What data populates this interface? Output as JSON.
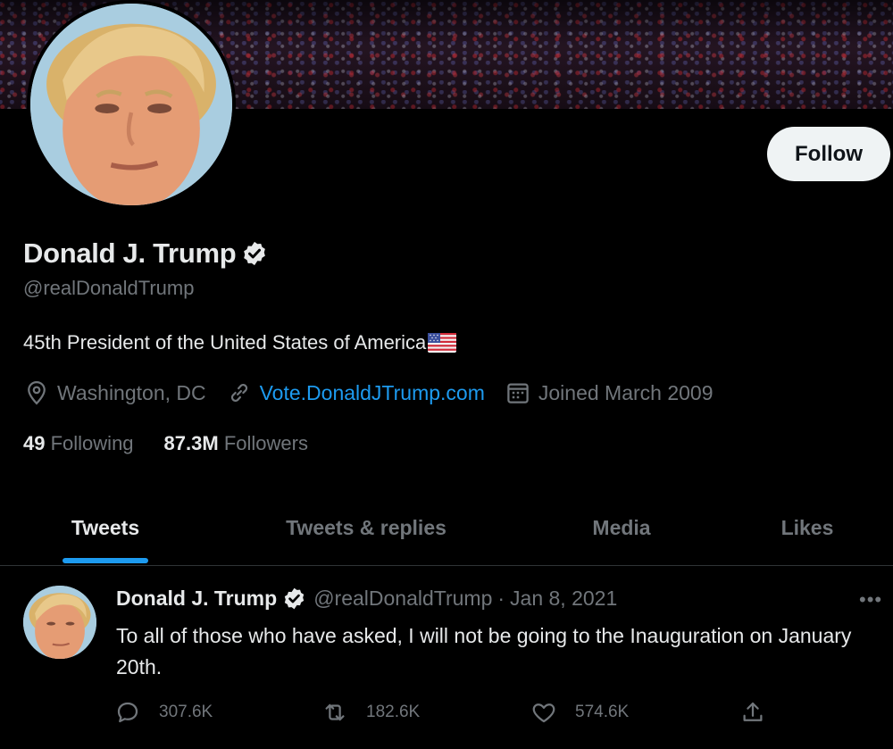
{
  "profile": {
    "display_name": "Donald J. Trump",
    "handle": "@realDonaldTrump",
    "bio": "45th President of the United States of America",
    "location": "Washington, DC",
    "website": "Vote.DonaldJTrump.com",
    "joined": "Joined March 2009",
    "following_count": "49",
    "following_label": "Following",
    "followers_count": "87.3M",
    "followers_label": "Followers",
    "follow_button": "Follow"
  },
  "tabs": [
    {
      "label": "Tweets",
      "active": true
    },
    {
      "label": "Tweets & replies",
      "active": false
    },
    {
      "label": "Media",
      "active": false
    },
    {
      "label": "Likes",
      "active": false
    }
  ],
  "tweet": {
    "author": "Donald J. Trump",
    "handle": "@realDonaldTrump",
    "separator": "·",
    "date": "Jan 8, 2021",
    "text": "To all of those who have asked, I will not be going to the Inauguration on January 20th.",
    "more": "•••",
    "replies": "307.6K",
    "retweets": "182.6K",
    "likes": "574.6K"
  },
  "icons": {
    "verified": "verified-badge-icon",
    "flag": "us-flag-icon",
    "location": "location-pin-icon",
    "link": "link-icon",
    "calendar": "calendar-icon",
    "reply": "reply-icon",
    "retweet": "retweet-icon",
    "like": "heart-icon",
    "share": "share-icon"
  },
  "colors": {
    "background": "#000000",
    "text": "#e7e9ea",
    "secondary": "#71767b",
    "accent": "#1d9bf0",
    "follow_bg": "#eff3f4"
  }
}
